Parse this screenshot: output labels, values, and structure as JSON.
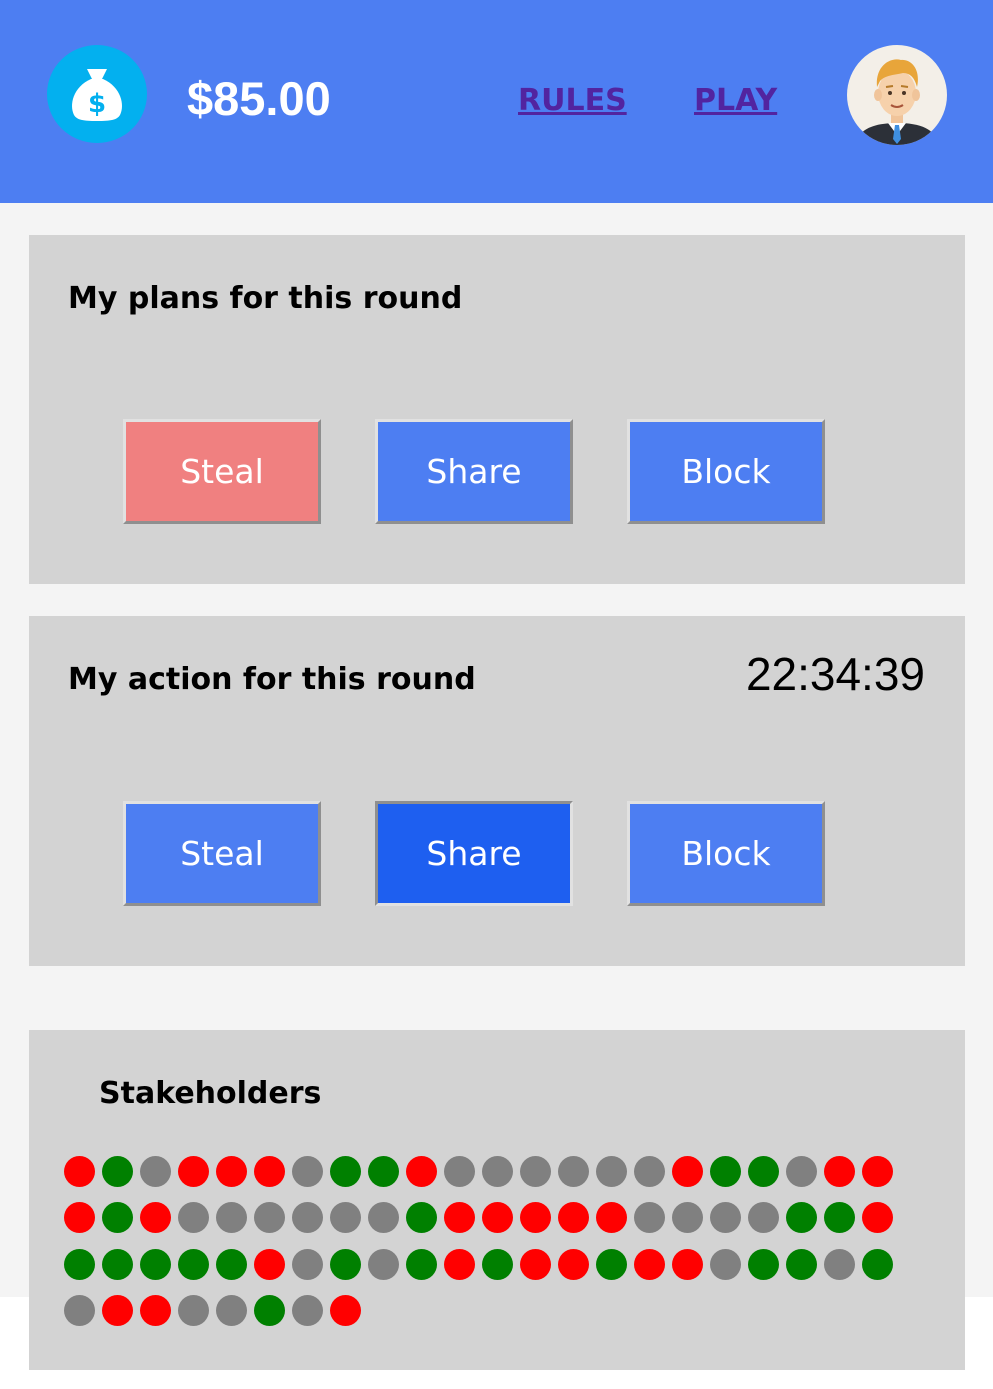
{
  "header": {
    "balance": "$85.00",
    "nav": {
      "rules": "RULES",
      "play": "PLAY"
    },
    "icons": {
      "money": "money-bag-icon",
      "avatar": "user-avatar"
    }
  },
  "plans": {
    "title": "My plans for this round",
    "buttons": [
      {
        "label": "Steal",
        "state": "selected"
      },
      {
        "label": "Share",
        "state": "default"
      },
      {
        "label": "Block",
        "state": "default"
      }
    ]
  },
  "action": {
    "title": "My action for this round",
    "timer": "22:34:39",
    "buttons": [
      {
        "label": "Steal",
        "state": "default"
      },
      {
        "label": "Share",
        "state": "pressed"
      },
      {
        "label": "Block",
        "state": "default"
      }
    ]
  },
  "stakeholders": {
    "title": "Stakeholders",
    "status_colors": {
      "red": "#ff0000",
      "green": "#008000",
      "gray": "#808080"
    },
    "rows": [
      [
        "red",
        "green",
        "gray",
        "red",
        "red",
        "red",
        "gray",
        "green",
        "green",
        "red",
        "gray",
        "gray",
        "gray",
        "gray",
        "gray",
        "gray",
        "red",
        "green",
        "green",
        "gray",
        "red",
        "red"
      ],
      [
        "red",
        "green",
        "red",
        "gray",
        "gray",
        "gray",
        "gray",
        "gray",
        "gray",
        "green",
        "red",
        "red",
        "red",
        "red",
        "red",
        "gray",
        "gray",
        "gray",
        "gray",
        "green",
        "green",
        "red"
      ],
      [
        "green",
        "green",
        "green",
        "green",
        "green",
        "red",
        "gray",
        "green",
        "gray",
        "green",
        "red",
        "green",
        "red",
        "red",
        "green",
        "red",
        "red",
        "gray",
        "green",
        "green",
        "gray",
        "green"
      ],
      [
        "gray",
        "red",
        "red",
        "gray",
        "gray",
        "green",
        "gray",
        "red"
      ]
    ]
  },
  "colors": {
    "header_bg": "#4d7ef2",
    "button_blue": "#4d7ef2",
    "button_red": "#f08080",
    "button_active": "#1e5ff0",
    "panel_bg": "#d3d3d3"
  }
}
